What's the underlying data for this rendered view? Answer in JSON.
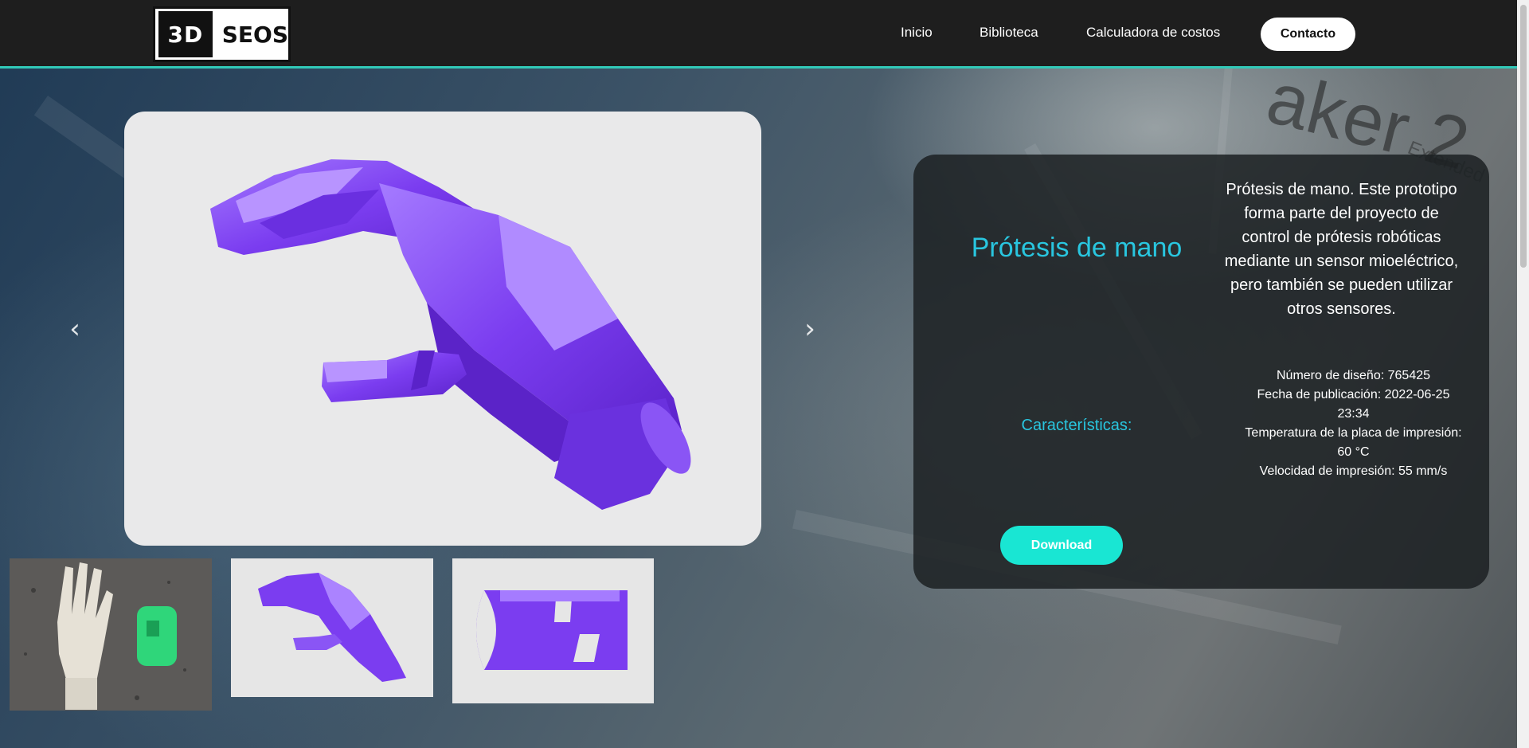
{
  "header": {
    "logo": {
      "left": "3D",
      "right": "SEOS"
    },
    "nav": [
      "Inicio",
      "Biblioteca",
      "Calculadora de costos"
    ],
    "contact_label": "Contacto"
  },
  "carousel": {
    "prev_icon": "chevron-left-icon",
    "next_icon": "chevron-right-icon",
    "thumbnails": [
      "photo-hand-prototype",
      "render-hand-purple",
      "render-socket-purple"
    ]
  },
  "product": {
    "title": "Prótesis de mano",
    "description": "Prótesis de mano. Este prototipo forma parte del proyecto de control de prótesis robóticas mediante un sensor mioeléctrico, pero también se pueden utilizar otros sensores.",
    "features_label": "Características:",
    "specs": [
      "Número de diseño: 765425",
      "Fecha de publicación: 2022-06-25 23:34",
      "Temperatura de la placa de impresión: 60 °C",
      "Velocidad de impresión: 55 mm/s"
    ],
    "download_label": "Download"
  },
  "background": {
    "brand_text": "aker 2",
    "brand_sub": "Extended"
  },
  "colors": {
    "accent": "#29c6df",
    "button": "#19e6d3",
    "header": "#1e1e1e",
    "model": "#7b3df0"
  }
}
